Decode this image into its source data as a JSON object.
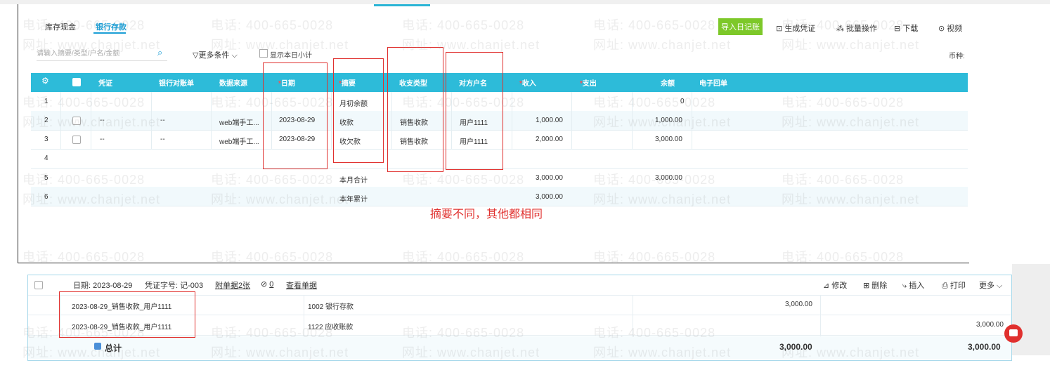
{
  "tabs": [
    {
      "label": "库存现金",
      "active": false
    },
    {
      "label": "银行存款",
      "active": true
    }
  ],
  "toolbar": {
    "import_label": "导入日记账",
    "generate_voucher_label": "生成凭证",
    "batch_label": "批量操作",
    "download_label": "下载",
    "video_label": "视频"
  },
  "filter": {
    "search_placeholder": "请输入摘要/类型/户名/金额",
    "more_conditions": "更多条件",
    "show_daily_subtotal": "显示本日小计",
    "currency_label": "币种:"
  },
  "table": {
    "columns": [
      "凭证",
      "银行对账单",
      "数据来源",
      "日期",
      "摘要",
      "收支类型",
      "对方户名",
      "收入",
      "支出",
      "余额",
      "电子回单"
    ],
    "required_marker": "*",
    "rows": [
      {
        "no": "1",
        "voucher": "",
        "statement": "",
        "source": "",
        "date": "",
        "summary": "月初余额",
        "type": "",
        "party": "",
        "income": "",
        "expense": "",
        "balance": "0"
      },
      {
        "no": "2",
        "voucher": "--",
        "statement": "--",
        "source": "web端手工...",
        "date": "2023-08-29",
        "summary": "收款",
        "type": "销售收款",
        "party": "用户1111",
        "income": "1,000.00",
        "expense": "",
        "balance": "1,000.00"
      },
      {
        "no": "3",
        "voucher": "--",
        "statement": "--",
        "source": "web端手工...",
        "date": "2023-08-29",
        "summary": "收欠款",
        "type": "销售收款",
        "party": "用户1111",
        "income": "2,000.00",
        "expense": "",
        "balance": "3,000.00"
      },
      {
        "no": "4",
        "voucher": "",
        "statement": "",
        "source": "",
        "date": "",
        "summary": "",
        "type": "",
        "party": "",
        "income": "",
        "expense": "",
        "balance": ""
      },
      {
        "no": "5",
        "voucher": "",
        "statement": "",
        "source": "",
        "date": "",
        "summary": "本月合计",
        "type": "",
        "party": "",
        "income": "3,000.00",
        "expense": "",
        "balance": "3,000.00"
      },
      {
        "no": "6",
        "voucher": "",
        "statement": "",
        "source": "",
        "date": "",
        "summary": "本年累计",
        "type": "",
        "party": "",
        "income": "3,000.00",
        "expense": "",
        "balance": ""
      }
    ]
  },
  "annotation": "摘要不同，其他都相同",
  "voucher": {
    "date_label": "日期: 2023-08-29",
    "number_label": "凭证字号: 记-003",
    "attachments": "附单据2张",
    "links": "0",
    "view_documents": "查看单据",
    "actions": [
      "修改",
      "删除",
      "插入",
      "打印",
      "更多"
    ],
    "entries": [
      {
        "summary": "2023-08-29_销售收款_用户1111",
        "account": "1002 银行存款",
        "debit": "3,000.00",
        "credit": ""
      },
      {
        "summary": "2023-08-29_销售收款_用户1111",
        "account": "1122 应收账款",
        "debit": "",
        "credit": "3,000.00"
      }
    ],
    "total_label": "总计",
    "total_debit": "3,000.00",
    "total_credit": "3,000.00"
  },
  "watermark": {
    "phone": "电话: 400-665-0028",
    "site": "网址: www.chanjet.net"
  }
}
